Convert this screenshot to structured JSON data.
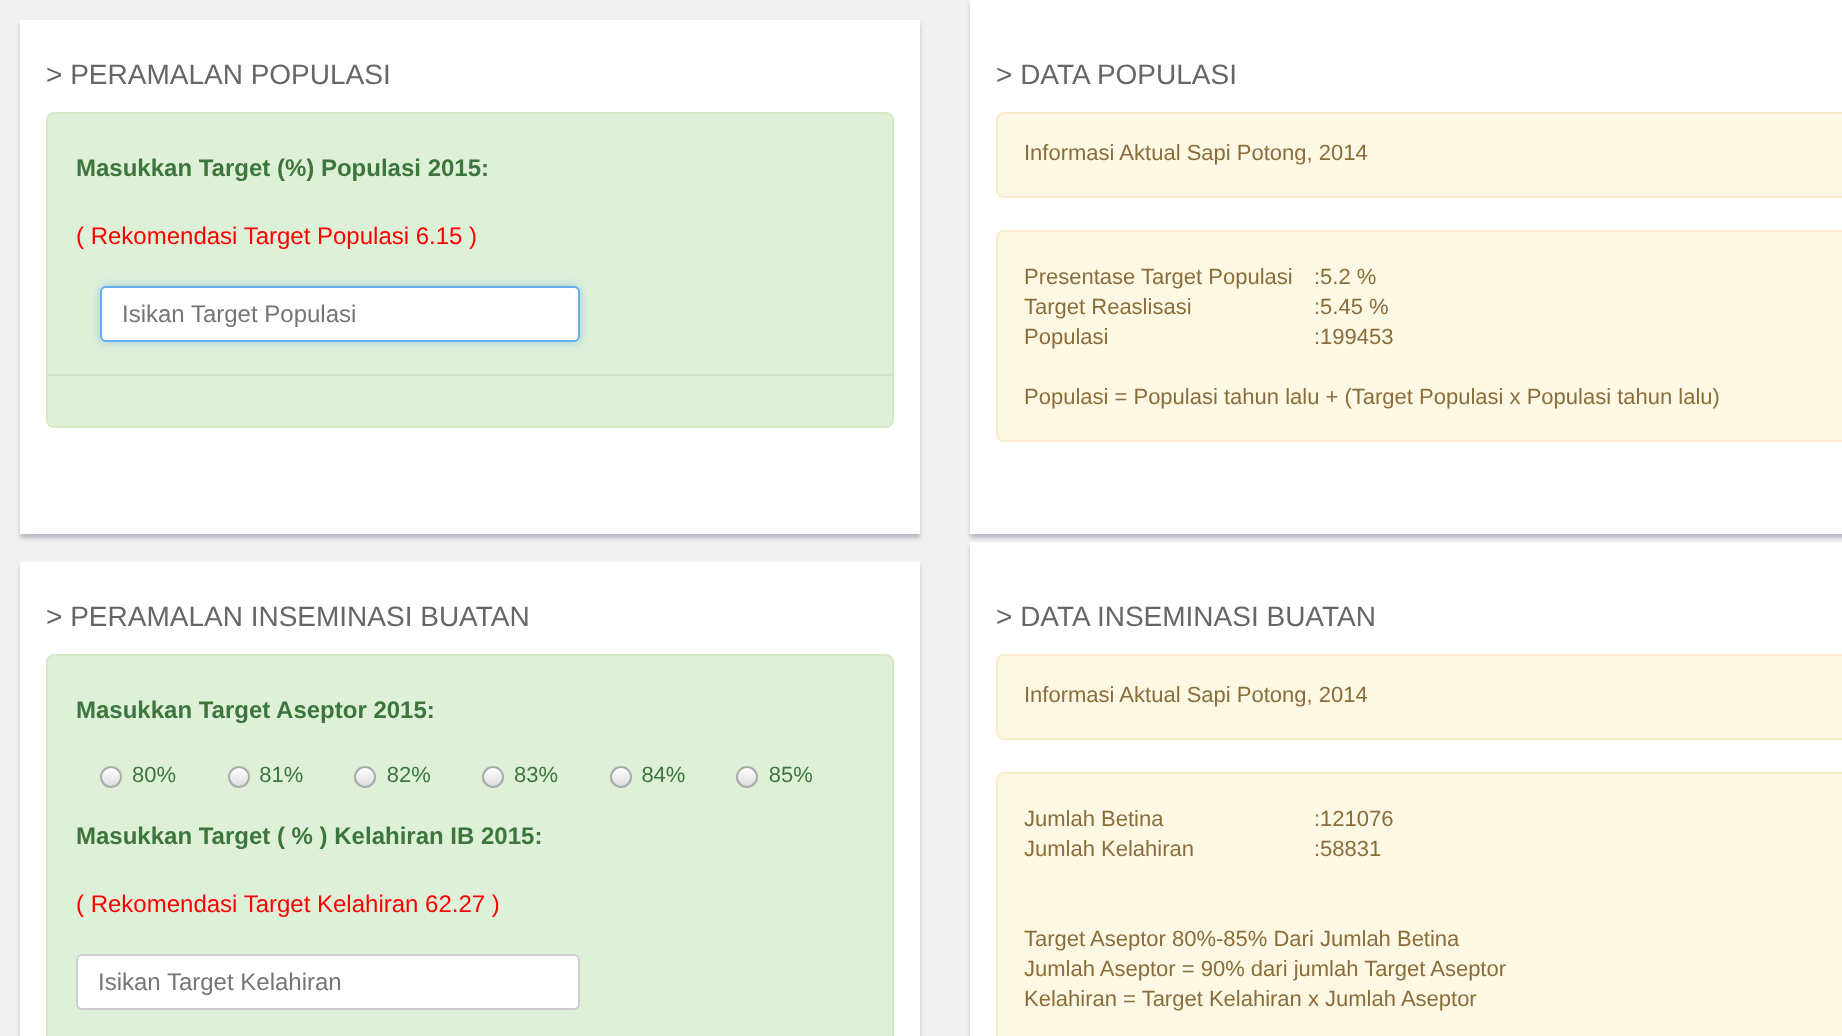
{
  "panels": [
    {
      "kind": "form",
      "title": "> PERAMALAN POPULASI",
      "items": [
        {
          "kind": "label",
          "text": "Masukkan Target (%) Populasi 2015:"
        },
        {
          "kind": "note",
          "text": "( Rekomendasi Target Populasi 6.15 )"
        },
        {
          "kind": "field",
          "placeholder": "Isikan Target Populasi",
          "focused": true
        }
      ]
    },
    {
      "kind": "data",
      "title": "> DATA POPULASI",
      "boxes": [
        {
          "lines": [
            {
              "kind": "text",
              "text": "Informasi Aktual Sapi Potong, 2014"
            }
          ]
        },
        {
          "lines": [
            {
              "kind": "pair",
              "label": "Presentase Target Populasi",
              "value": ":5.2 %"
            },
            {
              "kind": "pair",
              "label": "Target Reaslisasi",
              "value": ":5.45 %"
            },
            {
              "kind": "pair",
              "label": "Populasi",
              "value": ":199453"
            },
            {
              "kind": "gap"
            },
            {
              "kind": "text",
              "text": "Populasi = Populasi tahun lalu + (Target Populasi x Populasi tahun lalu)"
            }
          ]
        }
      ]
    },
    {
      "kind": "form",
      "title": "> PERAMALAN INSEMINASI BUATAN",
      "items": [
        {
          "kind": "label",
          "text": "Masukkan Target Aseptor 2015:"
        },
        {
          "kind": "radios",
          "options": [
            {
              "label": "80%",
              "checked": false
            },
            {
              "label": "81%",
              "checked": false
            },
            {
              "label": "82%",
              "checked": false
            },
            {
              "label": "83%",
              "checked": false
            },
            {
              "label": "84%",
              "checked": false
            },
            {
              "label": "85%",
              "checked": false
            }
          ]
        },
        {
          "kind": "label",
          "text": "Masukkan Target ( % ) Kelahiran IB 2015:"
        },
        {
          "kind": "note",
          "text": "( Rekomendasi Target Kelahiran 62.27 )"
        },
        {
          "kind": "field",
          "placeholder": "Isikan Target Kelahiran",
          "focused": false
        }
      ]
    },
    {
      "kind": "data",
      "title": "> DATA INSEMINASI BUATAN",
      "boxes": [
        {
          "lines": [
            {
              "kind": "text",
              "text": "Informasi Aktual Sapi Potong, 2014"
            }
          ]
        },
        {
          "lines": [
            {
              "kind": "pair",
              "label": "Jumlah Betina",
              "value": ":121076"
            },
            {
              "kind": "pair",
              "label": "Jumlah Kelahiran",
              "value": ":58831"
            },
            {
              "kind": "gap"
            },
            {
              "kind": "gap"
            },
            {
              "kind": "text",
              "text": "Target Aseptor 80%-85% Dari Jumlah Betina"
            },
            {
              "kind": "text",
              "text": "Jumlah Aseptor = 90% dari jumlah Target Aseptor"
            },
            {
              "kind": "text",
              "text": "Kelahiran = Target Kelahiran x Jumlah Aseptor"
            }
          ]
        }
      ]
    }
  ]
}
